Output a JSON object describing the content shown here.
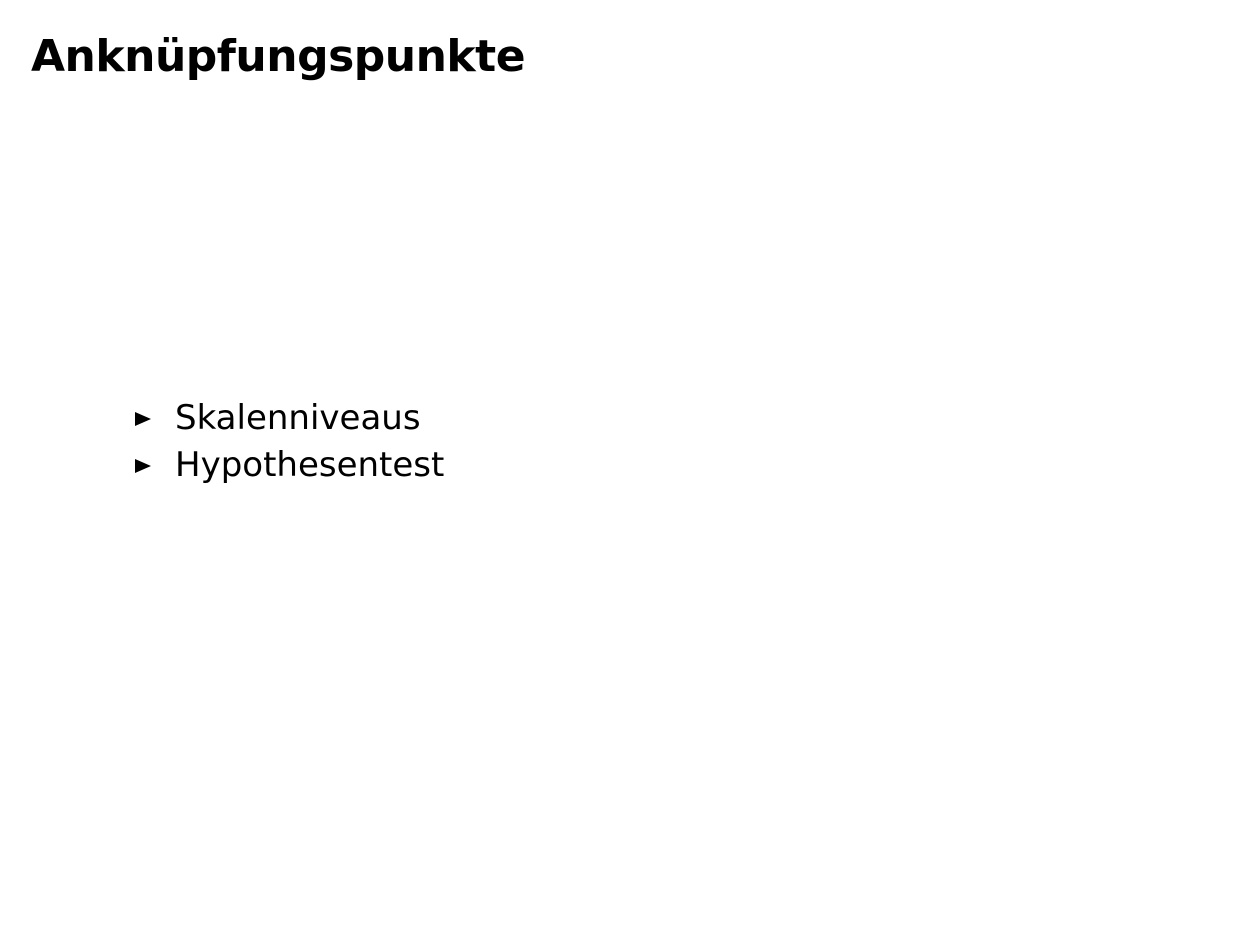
{
  "slide": {
    "title": "Anknüpfungspunkte",
    "bullets": [
      {
        "text": "Skalenniveaus",
        "icon": "triangle-right-icon"
      },
      {
        "text": "Hypothesentest",
        "icon": "triangle-right-icon"
      }
    ]
  }
}
